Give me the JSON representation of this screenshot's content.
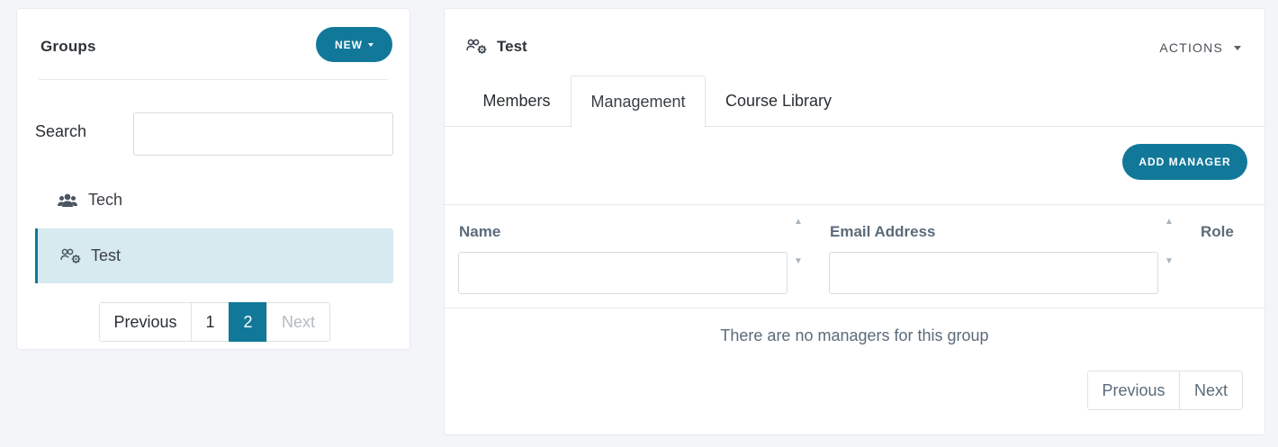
{
  "groups_panel": {
    "title": "Groups",
    "new_label": "NEW",
    "search_label": "Search",
    "search_value": "",
    "items": [
      {
        "label": "Tech",
        "icon": "users-icon",
        "selected": false
      },
      {
        "label": "Test",
        "icon": "users-gear-icon",
        "selected": true
      }
    ],
    "pagination": {
      "previous": "Previous",
      "pages": [
        "1",
        "2"
      ],
      "current": "2",
      "next": "Next"
    }
  },
  "detail_panel": {
    "title": "Test",
    "title_icon": "users-gear-icon",
    "actions_label": "ACTIONS",
    "tabs": [
      "Members",
      "Management",
      "Course Library"
    ],
    "active_tab": "Management",
    "add_manager_label": "ADD MANAGER",
    "table": {
      "columns": [
        "Name",
        "Email Address",
        "Role"
      ],
      "empty_message": "There are no managers for this group"
    },
    "pagination": {
      "previous": "Previous",
      "next": "Next"
    }
  },
  "colors": {
    "accent": "#12789a",
    "selected_row": "#d6eaf0",
    "background": "#f4f5f9",
    "muted_text": "#5b6b7b"
  }
}
